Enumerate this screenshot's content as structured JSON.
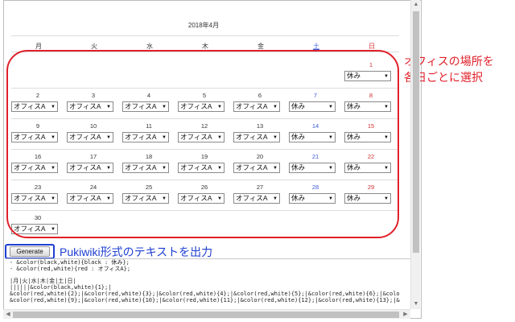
{
  "calendar": {
    "title": "2018年4月",
    "weekdays": [
      {
        "label": "月",
        "kind": "weekday"
      },
      {
        "label": "火",
        "kind": "weekday"
      },
      {
        "label": "水",
        "kind": "weekday"
      },
      {
        "label": "木",
        "kind": "weekday"
      },
      {
        "label": "金",
        "kind": "weekday"
      },
      {
        "label": "土",
        "kind": "sat"
      },
      {
        "label": "日",
        "kind": "sun"
      }
    ],
    "weeks": [
      [
        null,
        null,
        null,
        null,
        null,
        null,
        {
          "day": "1",
          "value": "休み"
        }
      ],
      [
        {
          "day": "2",
          "value": "オフィスA"
        },
        {
          "day": "3",
          "value": "オフィスA"
        },
        {
          "day": "4",
          "value": "オフィスA"
        },
        {
          "day": "5",
          "value": "オフィスA"
        },
        {
          "day": "6",
          "value": "オフィスA"
        },
        {
          "day": "7",
          "value": "休み"
        },
        {
          "day": "8",
          "value": "休み"
        }
      ],
      [
        {
          "day": "9",
          "value": "オフィスA"
        },
        {
          "day": "10",
          "value": "オフィスA"
        },
        {
          "day": "11",
          "value": "オフィスA"
        },
        {
          "day": "12",
          "value": "オフィスA"
        },
        {
          "day": "13",
          "value": "オフィスA"
        },
        {
          "day": "14",
          "value": "休み"
        },
        {
          "day": "15",
          "value": "休み"
        }
      ],
      [
        {
          "day": "16",
          "value": "オフィスA"
        },
        {
          "day": "17",
          "value": "オフィスA"
        },
        {
          "day": "18",
          "value": "オフィスA"
        },
        {
          "day": "19",
          "value": "オフィスA"
        },
        {
          "day": "20",
          "value": "オフィスA"
        },
        {
          "day": "21",
          "value": "休み"
        },
        {
          "day": "22",
          "value": "休み"
        }
      ],
      [
        {
          "day": "23",
          "value": "オフィスA"
        },
        {
          "day": "24",
          "value": "オフィスA"
        },
        {
          "day": "25",
          "value": "オフィスA"
        },
        {
          "day": "26",
          "value": "オフィスA"
        },
        {
          "day": "27",
          "value": "オフィスA"
        },
        {
          "day": "28",
          "value": "休み"
        },
        {
          "day": "29",
          "value": "休み"
        }
      ],
      [
        {
          "day": "30",
          "value": "オフィスA"
        },
        null,
        null,
        null,
        null,
        null,
        null
      ]
    ]
  },
  "annotations": {
    "calendar_note_line1": "オフィスの場所を",
    "calendar_note_line2": "各日ごとに選択",
    "generate_note": "Pukiwiki形式のテキストを出力"
  },
  "generate_button_label": "Generate",
  "output_lines": [
    "- &color(black,white){black : 休み};",
    "- &color(red,white){red : オフィスA};",
    "",
    "|月|火|水|木|金|土|日|",
    "||||||&color(black,white){1};|",
    "&color(red,white){2};|&color(red,white){3};|&color(red,white){4};|&color(red,white){5};|&color(red,white){6};|&colo",
    "&color(red,white){9};|&color(red,white){10};|&color(red,white){11};|&color(red,white){12};|&color(red,white){13};|&"
  ],
  "colors": {
    "accent_red": "#e0202a",
    "accent_blue": "#1f3fd1",
    "saturday": "#3b5bd9",
    "sunday": "#d32f2f"
  }
}
